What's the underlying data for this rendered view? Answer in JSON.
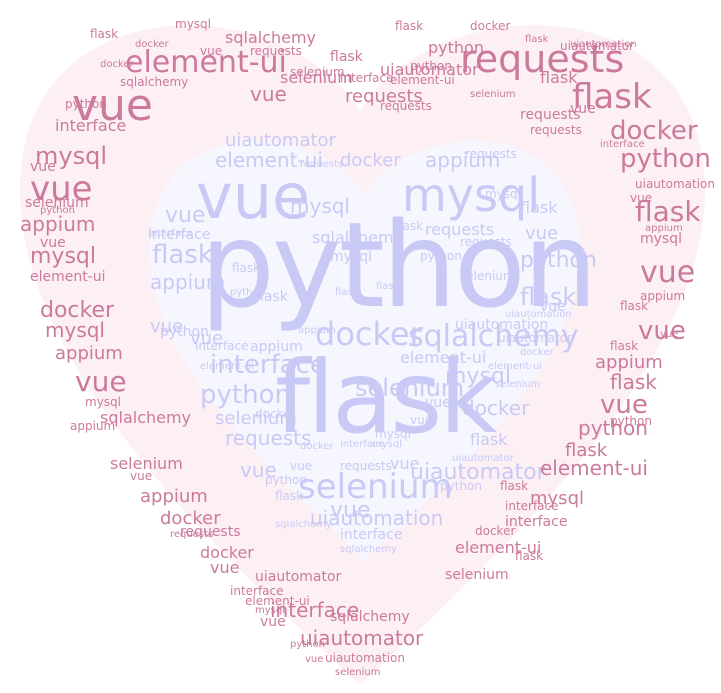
{
  "palette": {
    "outer_word_color": "#cc7a9c",
    "inner_word_color": "#c9c9f5",
    "outer_heart_fill": "#fdf0f5",
    "inner_heart_fill": "#f6f6fe"
  },
  "words": {
    "inner": [
      "python",
      "flask",
      "vue",
      "mysql",
      "element-ui",
      "uiautomator",
      "appium",
      "docker",
      "sqlalchemy",
      "selenium",
      "interface",
      "requests",
      "uiautomation",
      "vue",
      "flask",
      "mysql",
      "selenium",
      "docker",
      "interface",
      "python",
      "requests",
      "sqlalchemy",
      "appium",
      "vue",
      "flask",
      "uiautomator",
      "python",
      "element-ui",
      "vue",
      "mysql",
      "flask",
      "requests",
      "interface",
      "selenium",
      "docker",
      "vue",
      "python",
      "uiautomation",
      "flask",
      "mysql",
      "vue",
      "appium",
      "sqlalchemy",
      "interface",
      "requests",
      "python",
      "flask",
      "vue",
      "selenium",
      "uiautomator",
      "docker",
      "mysql",
      "flask",
      "vue",
      "interface",
      "requests",
      "python",
      "vue",
      "flask",
      "element-ui",
      "mysql",
      "appium",
      "docker",
      "vue",
      "selenium",
      "uiautomation",
      "flask",
      "python",
      "requests",
      "interface",
      "sqlalchemy",
      "vue",
      "mysql",
      "flask",
      "docker",
      "vue",
      "python",
      "uiautomator",
      "flask",
      "element-ui"
    ],
    "outer": [
      "element-ui",
      "vue",
      "requests",
      "flask",
      "mysql",
      "vue",
      "docker",
      "appium",
      "interface",
      "python",
      "selenium",
      "uiautomator",
      "uiautomation",
      "sqlalchemy",
      "flask",
      "vue",
      "mysql",
      "docker",
      "appium",
      "requests",
      "flask",
      "vue",
      "python",
      "element-ui",
      "selenium",
      "interface",
      "vue",
      "flask",
      "mysql",
      "docker",
      "uiautomator",
      "requests",
      "appium",
      "vue",
      "python",
      "flask",
      "sqlalchemy",
      "selenium",
      "interface",
      "element-ui",
      "vue",
      "mysql",
      "flask",
      "docker",
      "vue",
      "requests",
      "python",
      "appium",
      "uiautomation",
      "flask",
      "vue",
      "interface",
      "mysql",
      "selenium",
      "docker",
      "element-ui",
      "vue",
      "sqlalchemy",
      "flask",
      "python",
      "requests",
      "uiautomator",
      "appium",
      "vue",
      "mysql",
      "flask",
      "interface",
      "docker",
      "selenium",
      "vue",
      "python",
      "element-ui",
      "flask",
      "requests",
      "vue",
      "mysql",
      "appium",
      "uiautomation",
      "sqlalchemy",
      "docker",
      "interface",
      "vue",
      "flask",
      "selenium",
      "python",
      "requests",
      "element-ui",
      "mysql",
      "vue",
      "flask",
      "uiautomator",
      "appium",
      "docker",
      "vue",
      "interface",
      "python",
      "selenium",
      "flask",
      "requests",
      "vue"
    ]
  }
}
